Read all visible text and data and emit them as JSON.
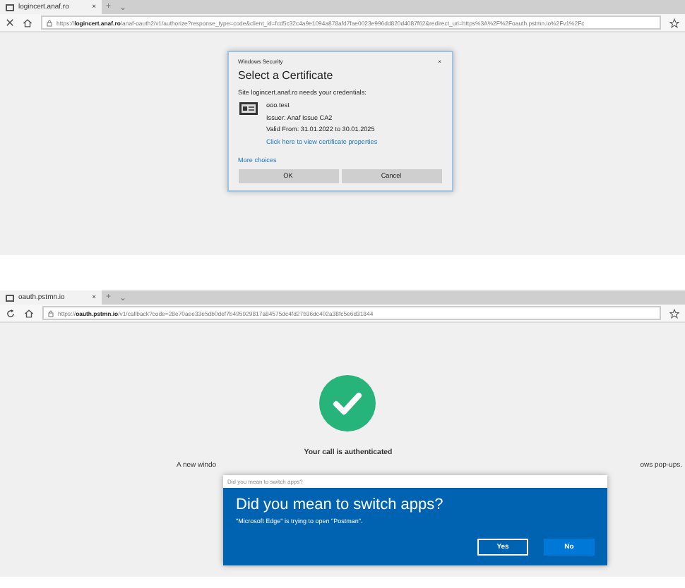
{
  "top_browser": {
    "tab": {
      "title": "logincert.anaf.ro",
      "close": "×"
    },
    "new_tab": "+",
    "tab_menu": "⌄",
    "address": {
      "scheme": "https://",
      "host": "logincert.anaf.ro",
      "path": "/anaf-oauth2/v1/authorize?response_type=code&client_id=fcd5c32c4a9e1094a878afd7fae0023e996dd820d4087f62&redirect_uri=https%3A%2F%2Foauth.pstmn.io%2Fv1%2Fc"
    }
  },
  "certificate_dialog": {
    "window_title": "Windows Security",
    "close": "×",
    "title": "Select a Certificate",
    "message": "Site logincert.anaf.ro needs your credentials:",
    "certificate": {
      "name": "ooo.test",
      "issuer": "Issuer: Anaf Issue CA2",
      "valid": "Valid From: 31.01.2022 to 30.01.2025",
      "link": "Click here to view certificate properties"
    },
    "more_choices": "More choices",
    "buttons": [
      "OK",
      "Cancel"
    ]
  },
  "bottom_browser": {
    "tab": {
      "title": "oauth.pstmn.io",
      "close": "×"
    },
    "new_tab": "+",
    "tab_menu": "⌄",
    "address": {
      "scheme": "https://",
      "host": "oauth.pstmn.io",
      "path": "/v1/callback?code=28e70aee33e5db0def7b495929817a84575dc4fd27b36dc402a38fc5e6d31844"
    }
  },
  "callback_page": {
    "status": "Your call is authenticated",
    "note_start": "A new windo",
    "note_end": "ows pop-ups."
  },
  "switch_dialog": {
    "window_title": "Did you mean to switch apps?",
    "title": "Did you mean to switch apps?",
    "message": "\"Microsoft Edge\" is trying to open \"Postman\".",
    "buttons": [
      {
        "label": "Yes",
        "selected": false
      },
      {
        "label": "No",
        "selected": true
      }
    ]
  }
}
